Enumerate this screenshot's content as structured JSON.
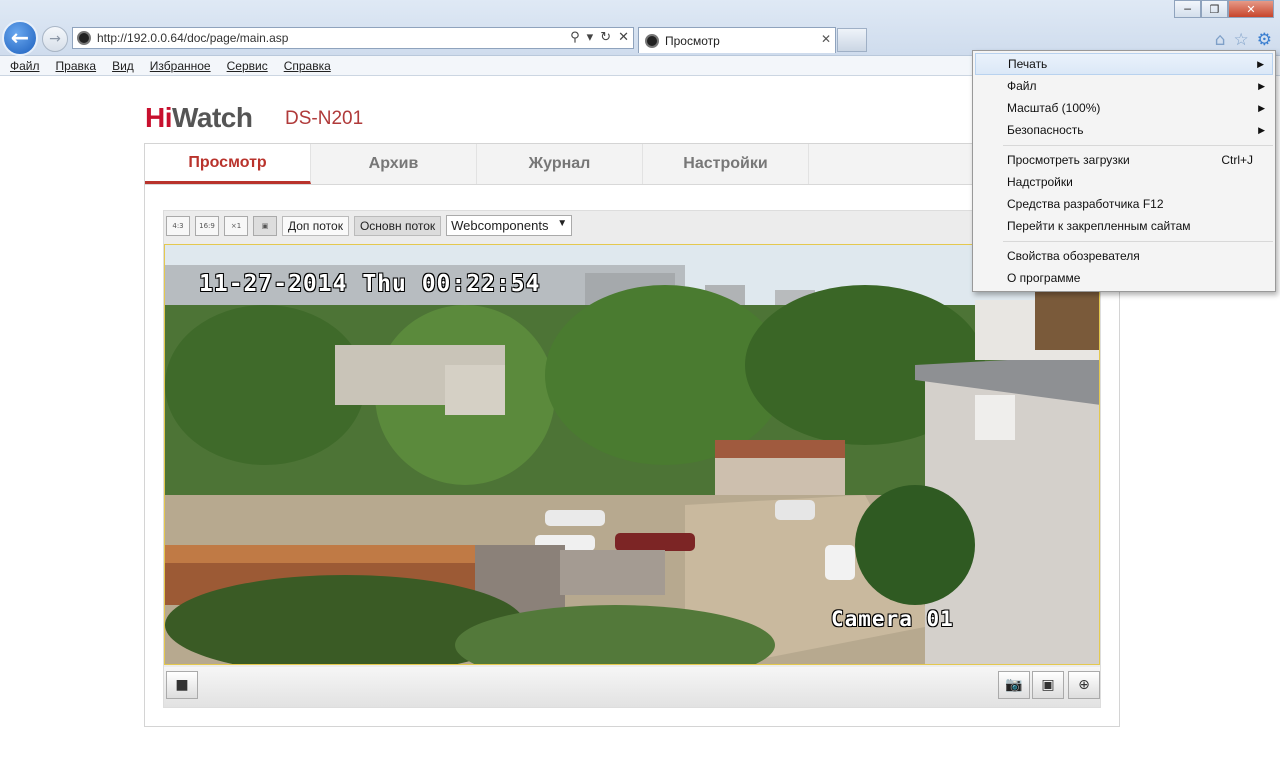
{
  "browser": {
    "url": "http://192.0.0.64/doc/page/main.asp",
    "tab_title": "Просмотр",
    "menubar": [
      "Файл",
      "Правка",
      "Вид",
      "Избранное",
      "Сервис",
      "Справка"
    ]
  },
  "app": {
    "brand_red": "Hi",
    "brand_gray": "Watch",
    "model": "DS-N201",
    "tabs": [
      {
        "label": "Просмотр",
        "active": true
      },
      {
        "label": "Архив",
        "active": false
      },
      {
        "label": "Журнал",
        "active": false
      },
      {
        "label": "Настройки",
        "active": false
      }
    ]
  },
  "viewer": {
    "ratio_buttons": [
      "4:3",
      "16:9",
      "×1"
    ],
    "stream_secondary": "Доп поток",
    "stream_main": "Основн поток",
    "plugin": "Webcomponents",
    "osd_time": "11-27-2014 Thu 00:22:54",
    "osd_camera": "Camera 01"
  },
  "context_menu": {
    "items": [
      {
        "label": "Печать",
        "submenu": true,
        "highlight": true
      },
      {
        "label": "Файл",
        "submenu": true
      },
      {
        "label": "Масштаб (100%)",
        "submenu": true
      },
      {
        "label": "Безопасность",
        "submenu": true
      },
      {
        "label": "Просмотреть загрузки",
        "shortcut": "Ctrl+J"
      },
      {
        "label": "Надстройки"
      },
      {
        "label": "Средства разработчика F12"
      },
      {
        "label": "Перейти к закрепленным сайтам"
      },
      {
        "label": "Свойства обозревателя"
      },
      {
        "label": "О программе"
      }
    ]
  },
  "colors": {
    "accent_red": "#b9332c",
    "ie_blue": "#1c5fbd"
  }
}
